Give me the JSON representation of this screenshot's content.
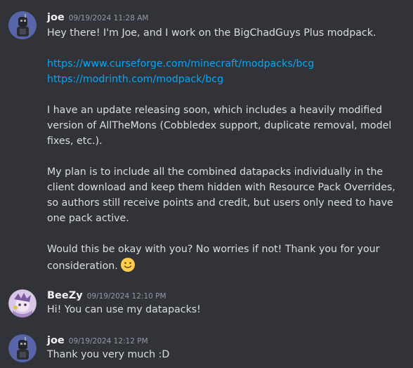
{
  "messages": [
    {
      "author": "joe",
      "timestamp": "09/19/2024 11:28 AM",
      "avatar_icon": "robot-avatar-icon",
      "lines": {
        "intro": "Hey there! I'm Joe, and I work on the BigChadGuys Plus modpack.",
        "link1": "https://www.curseforge.com/minecraft/modpacks/bcg",
        "link2": "https://modrinth.com/modpack/bcg",
        "p2_l1": "I have an update releasing soon, which includes a heavily modified",
        "p2_l2": "version of AllTheMons (Cobbledex support, duplicate removal, model",
        "p2_l3": "fixes, etc.).",
        "p3_l1": "My plan is to include all the combined datapacks individually in the",
        "p3_l2": "client download and keep them hidden with Resource Pack Overrides,",
        "p3_l3": "so authors still receive points and credit, but users only need to have",
        "p3_l4": "one pack active.",
        "p4_l1": "Would this be okay with you? No worries if not! Thank you for your",
        "p4_l2": "consideration."
      },
      "emoji": "slightly-smiling-face-emoji"
    },
    {
      "author": "BeeZy",
      "timestamp": "09/19/2024 12:10 PM",
      "avatar_icon": "character-avatar-icon",
      "text": "Hi! You can use my datapacks!"
    },
    {
      "author": "joe",
      "timestamp": "09/19/2024 12:12 PM",
      "avatar_icon": "robot-avatar-icon",
      "text": "Thank you very much :D"
    }
  ],
  "colors": {
    "background": "#313338",
    "text": "#dbdee1",
    "username": "#f2f3f5",
    "timestamp": "#949ba4",
    "link": "#00a8fc"
  }
}
